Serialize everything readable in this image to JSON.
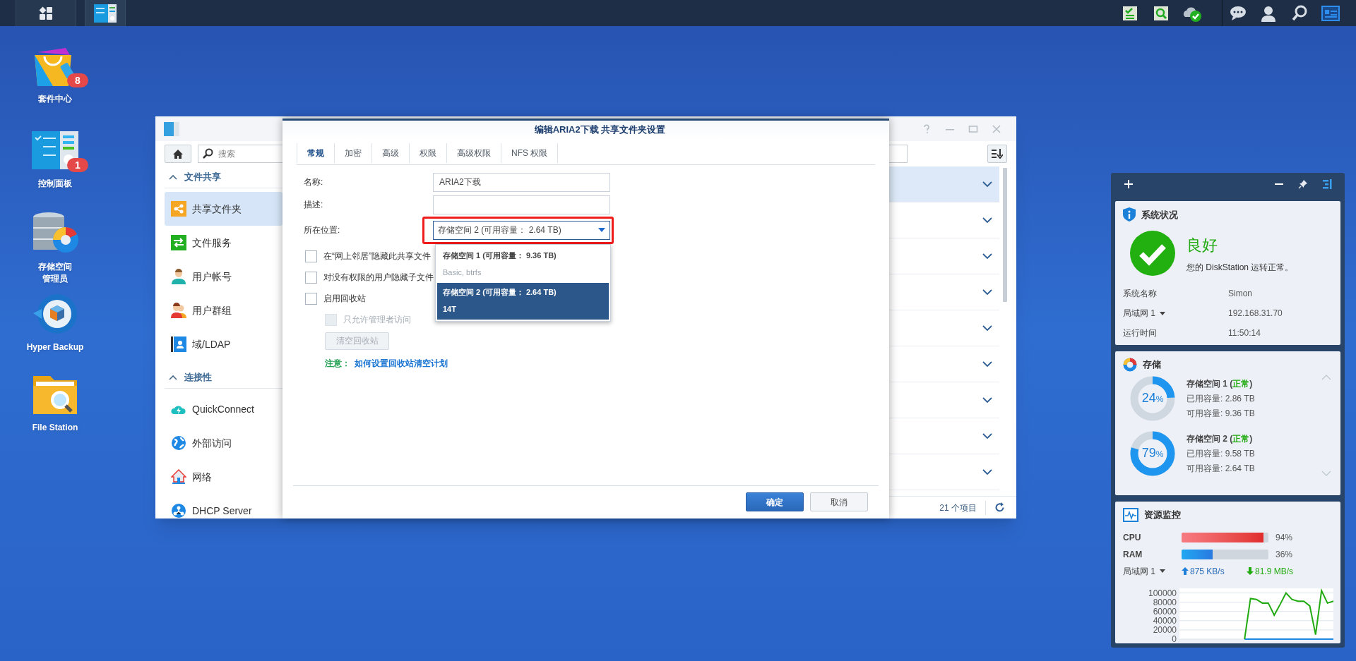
{
  "desktop_icons": [
    {
      "lines": [
        "套件中心"
      ],
      "badge": "8"
    },
    {
      "lines": [
        "控制面板"
      ],
      "badge": "1"
    },
    {
      "lines": [
        "存储空间",
        "管理员"
      ]
    },
    {
      "lines": [
        "Hyper Backup"
      ]
    },
    {
      "lines": [
        "File Station"
      ]
    }
  ],
  "control_panel": {
    "search": {
      "placeholder": "搜索"
    },
    "sections": [
      {
        "title": "文件共享",
        "expanded": true,
        "items": [
          {
            "label": "共享文件夹",
            "selected": true
          },
          {
            "label": "文件服务",
            "selected": false
          },
          {
            "label": "用户帐号",
            "selected": false
          },
          {
            "label": "用户群组",
            "selected": false
          },
          {
            "label": "域/LDAP",
            "selected": false
          }
        ]
      },
      {
        "title": "连接性",
        "expanded": true,
        "items": [
          {
            "label": "QuickConnect",
            "selected": false
          },
          {
            "label": "外部访问",
            "selected": false
          },
          {
            "label": "网络",
            "selected": false
          },
          {
            "label": "DHCP Server",
            "selected": false
          }
        ]
      }
    ],
    "rows": [
      {
        "selected": true
      },
      {
        "selected": false
      },
      {
        "selected": false
      },
      {
        "selected": false
      },
      {
        "selected": false
      },
      {
        "selected": false
      },
      {
        "selected": false
      },
      {
        "selected": false
      },
      {
        "selected": false
      }
    ],
    "status": "21 个项目"
  },
  "dialog": {
    "title": "编辑ARIA2下载 共享文件夹设置",
    "tabs": [
      {
        "label": "常规",
        "selected": true
      },
      {
        "label": "加密",
        "selected": false
      },
      {
        "label": "高级",
        "selected": false
      },
      {
        "label": "权限",
        "selected": false
      },
      {
        "label": "高级权限",
        "selected": false
      },
      {
        "label": "NFS 权限",
        "selected": false
      }
    ],
    "fields": [
      {
        "label": "名称:",
        "value": "ARIA2下载"
      },
      {
        "label": "描述:"
      }
    ],
    "location": {
      "label": "所在位置:",
      "value": "存储空间 2 (可用容量： 2.64 TB)",
      "highlighted": true,
      "expanded": true,
      "options": [
        {
          "title": "存储空间 1 (可用容量： 9.36 TB)",
          "detail": "Basic, btrfs",
          "selected": false
        },
        {
          "title": "存储空间 2 (可用容量： 2.64 TB)",
          "detail": "14T",
          "selected": true
        }
      ]
    },
    "checkboxes": [
      {
        "label": "在“网上邻居”隐藏此共享文件",
        "checked": false
      },
      {
        "label": "对没有权限的用户隐藏子文件",
        "checked": false
      },
      {
        "label": "启用回收站",
        "checked": false,
        "children": [
          {
            "label": "只允许管理者访问",
            "checked": false,
            "disabled": true
          }
        ]
      }
    ],
    "clear_button": {
      "label": "清空回收站",
      "disabled": true
    },
    "note": {
      "label": "注意：",
      "link": "如何设置回收站清空计划"
    },
    "buttons": [
      {
        "label": "确定",
        "kind": "primary"
      },
      {
        "label": "取消",
        "kind": "secondary"
      }
    ]
  },
  "widgets": {
    "system": {
      "title": "系统状况",
      "status": "良好",
      "message": "您的 DiskStation 运转正常。",
      "rows": [
        {
          "label": "系统名称",
          "value": "Simon",
          "kind": "plain"
        },
        {
          "label": "局域网 1",
          "value": "192.168.31.70",
          "kind": "select"
        },
        {
          "label": "运行时间",
          "value": "11:50:14",
          "kind": "plain"
        }
      ]
    },
    "storage": {
      "title": "存储",
      "volumes": [
        {
          "name": "存储空间 1 (",
          "status": "正常",
          "name_end": ")",
          "used": "已用容量: 2.86 TB",
          "free": "可用容量: 9.36 TB",
          "level": 0.24,
          "percent": "24",
          "unit": "%"
        },
        {
          "name": "存储空间 2 (",
          "status": "正常",
          "name_end": ")",
          "used": "已用容量: 9.58 TB",
          "free": "可用容量: 2.64 TB",
          "level": 0.79,
          "percent": "79",
          "unit": "%"
        }
      ]
    },
    "resource": {
      "title": "资源监控",
      "meters": [
        {
          "label": "CPU",
          "level": 0.94,
          "reading": "94%"
        },
        {
          "label": "RAM",
          "level": 0.36,
          "reading": "36%"
        }
      ],
      "network": {
        "label": "局域网 1",
        "upload": "875 KB/s",
        "download": "81.9 MB/s"
      },
      "chart_data": {
        "type": "line",
        "grid": true,
        "ylim": [
          0,
          110000
        ],
        "yticks": [
          0,
          20000,
          40000,
          60000,
          80000,
          100000
        ],
        "series": [
          {
            "color": "#1e88e5",
            "values": [
              null,
              null,
              null,
              null,
              null,
              null,
              null,
              null,
              null,
              null,
              null,
              0,
              0,
              0,
              0,
              0,
              0,
              0,
              0,
              0,
              0,
              0,
              0,
              0,
              0,
              0,
              0
            ]
          },
          {
            "color": "#22aa11",
            "values": [
              null,
              null,
              null,
              null,
              null,
              null,
              null,
              null,
              null,
              null,
              null,
              0,
              88000,
              86000,
              78000,
              78000,
              52000,
              75000,
              100000,
              86000,
              82000,
              82000,
              72000,
              10000,
              105000,
              78000,
              82000
            ]
          }
        ]
      }
    }
  }
}
